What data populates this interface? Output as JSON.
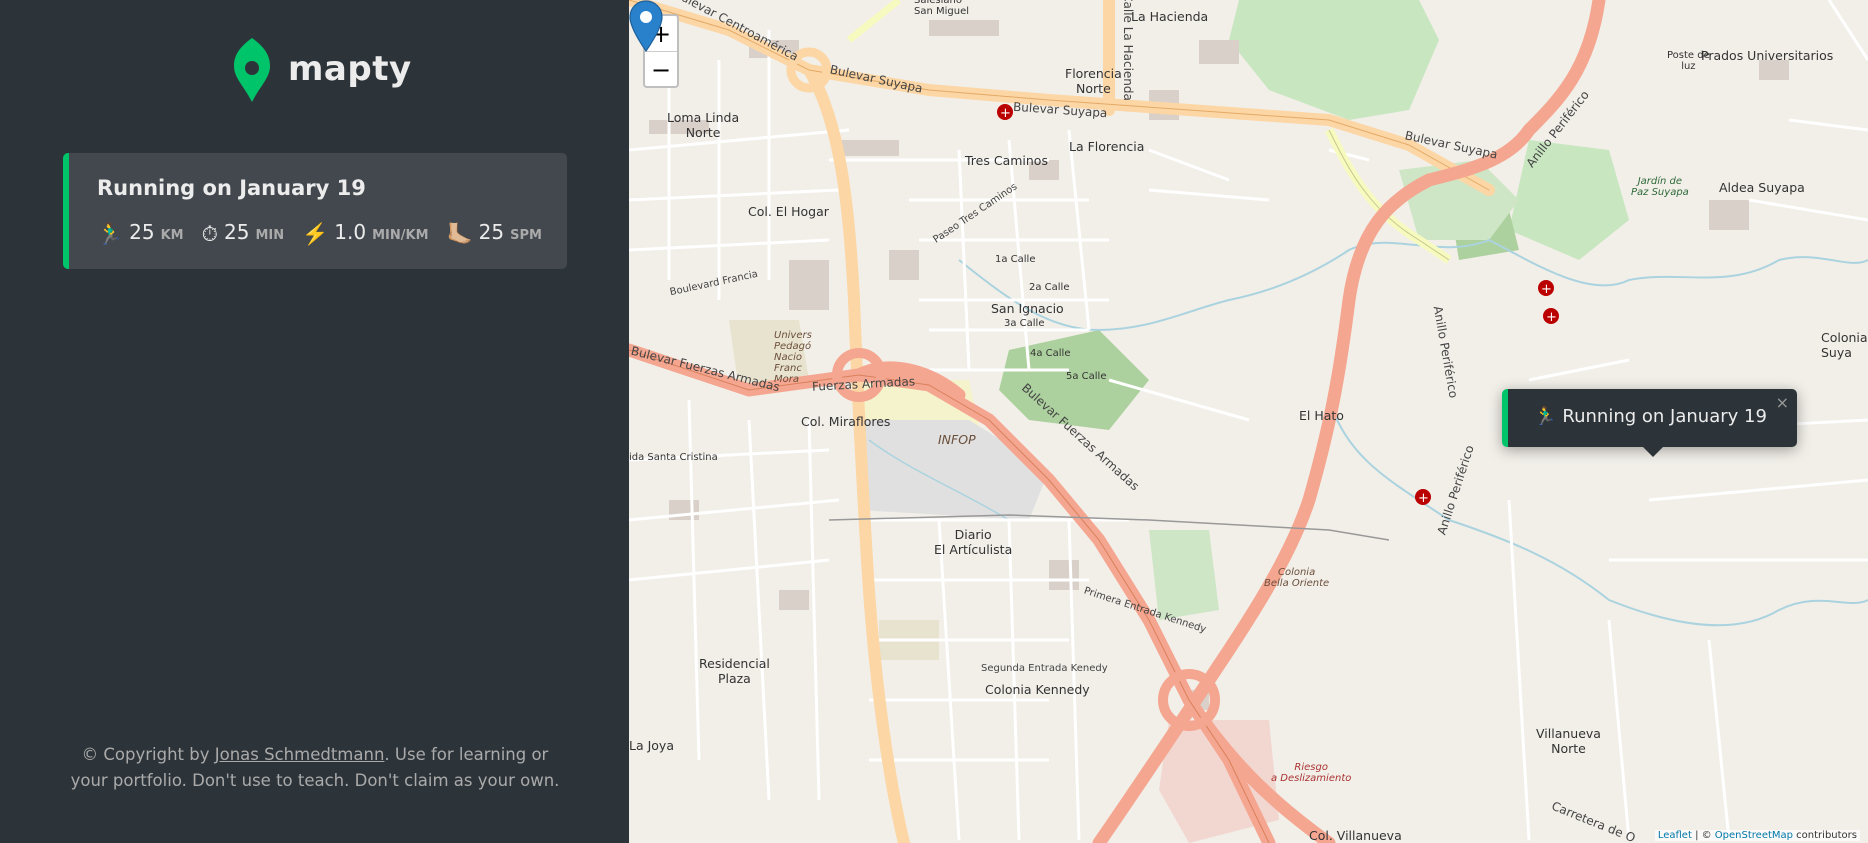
{
  "app": {
    "name": "mapty",
    "brand_color": "#00c46a",
    "logo_icon": "map-pin-icon"
  },
  "workouts": [
    {
      "title": "Running on January 19",
      "type": "running",
      "accent": "#00c46a",
      "details": [
        {
          "icon": "runner",
          "emoji": "🏃‍♂️",
          "value": "25",
          "unit": "KM"
        },
        {
          "icon": "stopwatch",
          "emoji": "⏱",
          "value": "25",
          "unit": "MIN"
        },
        {
          "icon": "lightning",
          "emoji": "⚡️",
          "value": "1.0",
          "unit": "MIN/KM"
        },
        {
          "icon": "footprint",
          "emoji": "🦶🏼",
          "value": "25",
          "unit": "SPM"
        }
      ]
    }
  ],
  "copyright": {
    "prefix": "© Copyright by ",
    "author": "Jonas Schmedtmann",
    "suffix": ". Use for learning or your portfolio. Don't use to teach. Don't claim as your own."
  },
  "map": {
    "zoom_in": "+",
    "zoom_out": "−",
    "popup": {
      "emoji": "🏃‍♂️",
      "text": "Running on January 19",
      "close": "×"
    },
    "attribution": {
      "leaflet": "Leaflet",
      "separator": " | © ",
      "osm": "OpenStreetMap",
      "suffix": " contributors"
    },
    "labels": {
      "centroamerica": "Bulevar Centroamérica",
      "sm": "Salesiano\nSan Miguel",
      "hacienda_rd": "Calle La Hacienda",
      "la_hacienda": "La Hacienda",
      "poste": "Poste de\nluz",
      "prados": "Prados Universitarios",
      "suyapa1": "Bulevar Suyapa",
      "suyapa2": "Bulevar Suyapa",
      "suyapa3": "Bulevar Suyapa",
      "florencia_norte": "Florencia\nNorte",
      "loma_linda": "Loma Linda\nNorte",
      "tres_caminos": "Tres Caminos",
      "la_florencia": "La Florencia",
      "anillo1": "Anillo Periférico",
      "aldea_suyapa": "Aldea Suyapa",
      "jardin": "Jardín de\nPaz Suyapa",
      "col_el_hogar": "Col. El Hogar",
      "boulevard_francia": "Boulevard Francia",
      "paseo_tres": "Paseo Tres Caminos",
      "calle1": "1a Calle",
      "san_ignacio": "San Ignacio",
      "calle3": "3a Calle",
      "calle2": "2a Calle",
      "calle4": "4a Calle",
      "calle5": "5a Calle",
      "univ": "Univers\nPedagó\nNacio\nFranc\nMora",
      "ffaa1": "Bulevar Fuerzas Armadas",
      "ffaa2": "Fuerzas Armadas",
      "ffaa3": "Bulevar Fuerzas Armadas",
      "miraflores": "Col. Miraflores",
      "infop": "INFOP",
      "el_hato": "El Hato",
      "anillo2": "Anillo Periférico",
      "anillo3": "Anillo Periférico",
      "colonia_suyapa": "Colonia\nSuya",
      "santa_cristina": "ida Santa Cristina",
      "diario": "Diario\nEl Artículista",
      "colonia_bella": "Colonia\nBella Oriente",
      "primera_entrada": "Primera Entrada Kennedy",
      "segunda_entrada": "Segunda Entrada Kenedy",
      "colonia_kennedy": "Colonia Kennedy",
      "residencial": "Residencial\nPlaza",
      "la_joya": "La Joya",
      "riesgo": "Riesgo\na Deslizamiento",
      "villanueva_norte": "Villanueva\nNorte",
      "col_villanueva": "Col. Villanueva",
      "carretera": "Carretera de O"
    }
  }
}
